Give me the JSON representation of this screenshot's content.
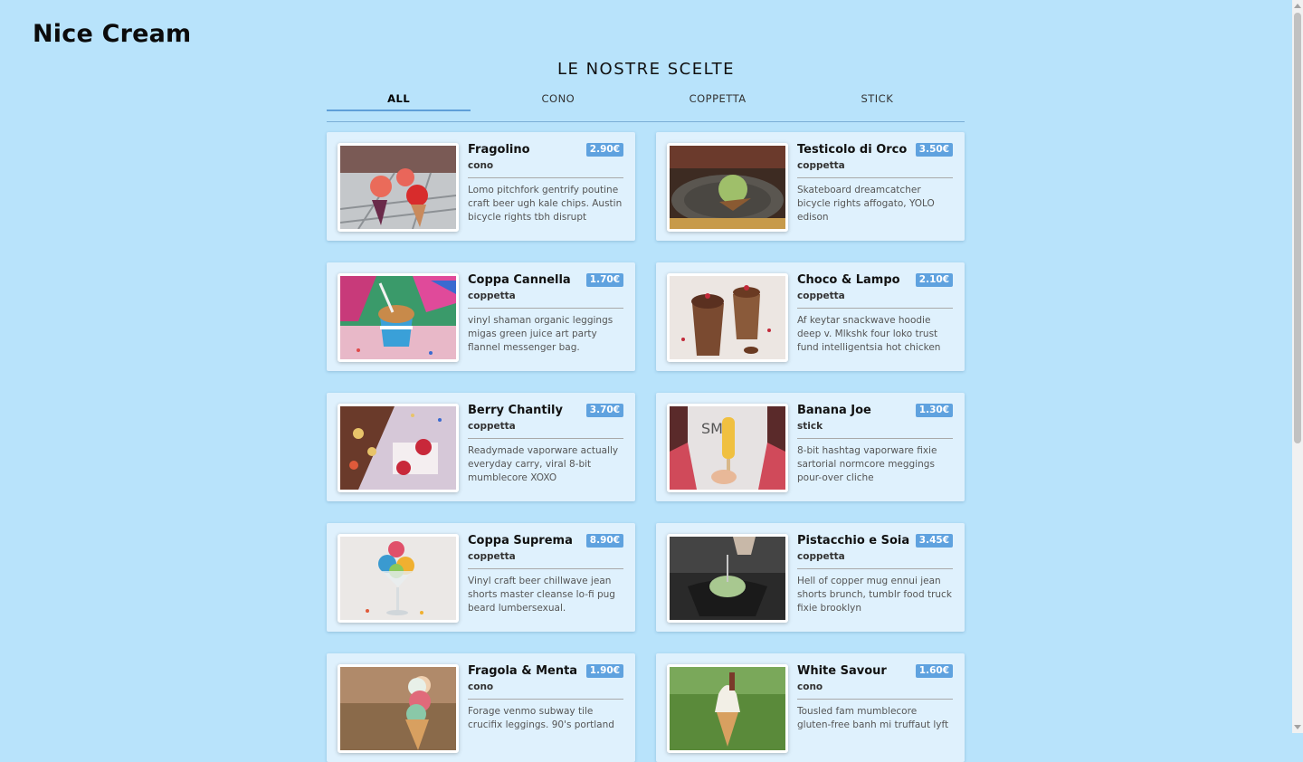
{
  "brand": "Nice Cream",
  "section_title": "Le nostre scelte",
  "tabs": [
    {
      "label": "ALL"
    },
    {
      "label": "CONO"
    },
    {
      "label": "COPPETTA"
    },
    {
      "label": "STICK"
    }
  ],
  "products": [
    {
      "name": "Fragolino",
      "price": "2.90€",
      "category": "cono",
      "description": "Lomo pitchfork gentrify poutine craft beer ugh kale chips. Austin bicycle rights tbh disrupt"
    },
    {
      "name": "Testicolo di Orco",
      "price": "3.50€",
      "category": "coppetta",
      "description": "Skateboard dreamcatcher bicycle rights affogato, YOLO edison"
    },
    {
      "name": "Coppa Cannella",
      "price": "1.70€",
      "category": "coppetta",
      "description": "vinyl shaman organic leggings migas green juice art party flannel messenger bag."
    },
    {
      "name": "Choco & Lampo",
      "price": "2.10€",
      "category": "coppetta",
      "description": "Af keytar snackwave hoodie deep v. Mlkshk four loko trust fund intelligentsia hot chicken"
    },
    {
      "name": "Berry Chantily",
      "price": "3.70€",
      "category": "coppetta",
      "description": "Readymade vaporware actually everyday carry, viral 8-bit mumblecore XOXO"
    },
    {
      "name": "Banana Joe",
      "price": "1.30€",
      "category": "stick",
      "description": "8-bit hashtag vaporware fixie sartorial normcore meggings pour-over cliche"
    },
    {
      "name": "Coppa Suprema",
      "price": "8.90€",
      "category": "coppetta",
      "description": "Vinyl craft beer chillwave jean shorts master cleanse lo-fi pug beard lumbersexual."
    },
    {
      "name": "Pistacchio e Soia",
      "price": "3.45€",
      "category": "coppetta",
      "description": "Hell of copper mug ennui jean shorts brunch, tumblr food truck fixie brooklyn"
    },
    {
      "name": "Fragola & Menta",
      "price": "1.90€",
      "category": "cono",
      "description": "Forage venmo subway tile crucifix leggings. 90's portland"
    },
    {
      "name": "White Savour",
      "price": "1.60€",
      "category": "cono",
      "description": "Tousled fam mumblecore gluten-free banh mi truffaut lyft"
    }
  ]
}
